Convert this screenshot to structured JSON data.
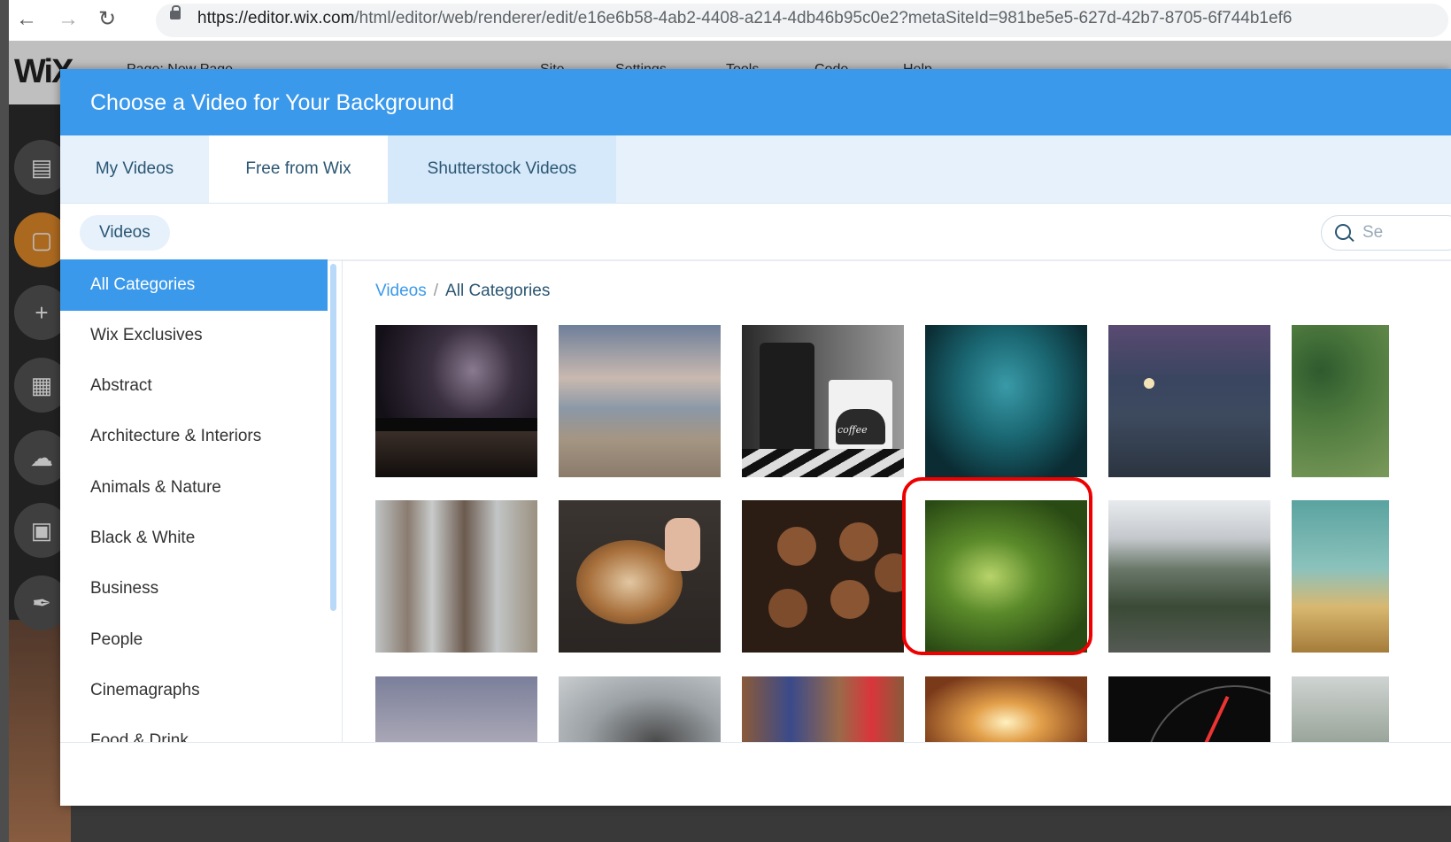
{
  "browser": {
    "url_host": "https://editor.wix.com",
    "url_rest": "/html/editor/web/renderer/edit/e16e6b58-4ab2-4408-a214-4db46b95c0e2?metaSiteId=981be5e5-627d-42b7-8705-6f744b1ef6"
  },
  "wix": {
    "logo": "WiX",
    "menu": [
      "Page: New Page",
      "Site",
      "Settings",
      "Tools",
      "Code",
      "Help"
    ]
  },
  "modal": {
    "title": "Choose a Video for Your Background",
    "tabs": [
      {
        "label": "My Videos"
      },
      {
        "label": "Free from Wix"
      },
      {
        "label": "Shutterstock Videos"
      }
    ],
    "filter_pill": "Videos",
    "search_placeholder": "Se",
    "categories": [
      "All Categories",
      "Wix Exclusives",
      "Abstract",
      "Architecture & Interiors",
      "Animals & Nature",
      "Black & White",
      "Business",
      "People",
      "Cinemagraphs",
      "Food & Drink"
    ],
    "breadcrumb": {
      "link": "Videos",
      "separator": "/",
      "current": "All Categories"
    },
    "thumbnail_text": "coffee"
  },
  "colors": {
    "accent": "#3b99eb",
    "highlight": "#e00000"
  }
}
